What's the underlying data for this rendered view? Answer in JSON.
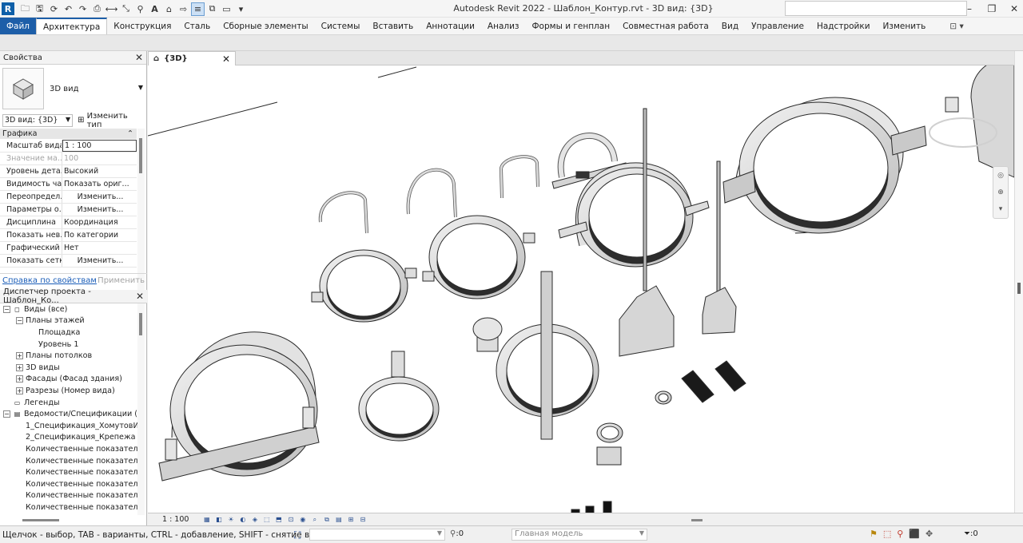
{
  "app": {
    "title": "Autodesk Revit 2022 - Шаблон_Контур.rvt - 3D вид: {3D}",
    "logo": "R"
  },
  "qat": {
    "icons": [
      "open-icon",
      "save-icon",
      "sync-icon",
      "undo-icon",
      "redo-icon",
      "print-icon",
      "measure-icon",
      "dimension-icon",
      "tag-icon",
      "text-icon",
      "3d-view-icon",
      "section-icon",
      "thin-lines-icon",
      "close-hidden-icon",
      "switch-windows-icon",
      "customize-icon"
    ]
  },
  "ribbon": {
    "tabs": [
      "Файл",
      "Архитектура",
      "Конструкция",
      "Сталь",
      "Сборные элементы",
      "Системы",
      "Вставить",
      "Аннотации",
      "Анализ",
      "Формы и генплан",
      "Совместная работа",
      "Вид",
      "Управление",
      "Надстройки",
      "Изменить"
    ],
    "active_tab": "Архитектура",
    "extra": "⊡ ▾"
  },
  "properties": {
    "title": "Свойства",
    "type_name": "3D вид",
    "view_selector": "3D вид: {3D}",
    "edit_type_label": "Изменить тип",
    "group_label": "Графика",
    "rows": [
      {
        "key": "Масштаб вида",
        "value": "1 : 100",
        "kind": "input"
      },
      {
        "key": "Значение ма...",
        "value": "100",
        "kind": "gray"
      },
      {
        "key": "Уровень дета...",
        "value": "Высокий",
        "kind": "text"
      },
      {
        "key": "Видимость ча...",
        "value": "Показать ориг...",
        "kind": "text"
      },
      {
        "key": "Переопредел...",
        "value": "Изменить...",
        "kind": "button"
      },
      {
        "key": "Параметры о...",
        "value": "Изменить...",
        "kind": "button"
      },
      {
        "key": "Дисциплина",
        "value": "Координация",
        "kind": "text"
      },
      {
        "key": "Показать нев...",
        "value": "По категории",
        "kind": "text"
      },
      {
        "key": "Графический ...",
        "value": "Нет",
        "kind": "text"
      },
      {
        "key": "Показать сетки",
        "value": "Изменить...",
        "kind": "button"
      }
    ],
    "help_link": "Справка по свойствам",
    "apply": "Применить"
  },
  "project_browser": {
    "title": "Диспетчер проекта - Шаблон_Ко...",
    "items": [
      {
        "label": "Виды (все)",
        "level": 0,
        "exp": "−",
        "icon": "views-icon"
      },
      {
        "label": "Планы этажей",
        "level": 1,
        "exp": "−",
        "icon": ""
      },
      {
        "label": "Площадка",
        "level": 2,
        "exp": "",
        "icon": ""
      },
      {
        "label": "Уровень 1",
        "level": 2,
        "exp": "",
        "icon": ""
      },
      {
        "label": "Планы потолков",
        "level": 1,
        "exp": "+",
        "icon": ""
      },
      {
        "label": "3D виды",
        "level": 1,
        "exp": "+",
        "icon": ""
      },
      {
        "label": "Фасады (Фасад здания)",
        "level": 1,
        "exp": "+",
        "icon": ""
      },
      {
        "label": "Разрезы (Номер вида)",
        "level": 1,
        "exp": "+",
        "icon": ""
      },
      {
        "label": "Легенды",
        "level": 0,
        "exp": "",
        "icon": "legend-icon"
      },
      {
        "label": "Ведомости/Спецификации (",
        "level": 0,
        "exp": "−",
        "icon": "schedule-icon"
      },
      {
        "label": "1_Спецификация_ХомутовИ",
        "level": 1,
        "exp": "",
        "icon": ""
      },
      {
        "label": "2_Спецификация_Крепежа",
        "level": 1,
        "exp": "",
        "icon": ""
      },
      {
        "label": "Количественные показател",
        "level": 1,
        "exp": "",
        "icon": ""
      },
      {
        "label": "Количественные показател",
        "level": 1,
        "exp": "",
        "icon": ""
      },
      {
        "label": "Количественные показател",
        "level": 1,
        "exp": "",
        "icon": ""
      },
      {
        "label": "Количественные показател",
        "level": 1,
        "exp": "",
        "icon": ""
      },
      {
        "label": "Количественные показател",
        "level": 1,
        "exp": "",
        "icon": ""
      },
      {
        "label": "Количественные показател",
        "level": 1,
        "exp": "",
        "icon": ""
      }
    ]
  },
  "view": {
    "tab_label": "{3D}",
    "scale": "1 : 100"
  },
  "status": {
    "hint": "Щелчок - выбор, TAB - варианты, CTRL - добавление, SHIFT - снятие выбора.",
    "sync_count": ":0",
    "model": "Главная модель",
    "filter_count": ":0"
  }
}
